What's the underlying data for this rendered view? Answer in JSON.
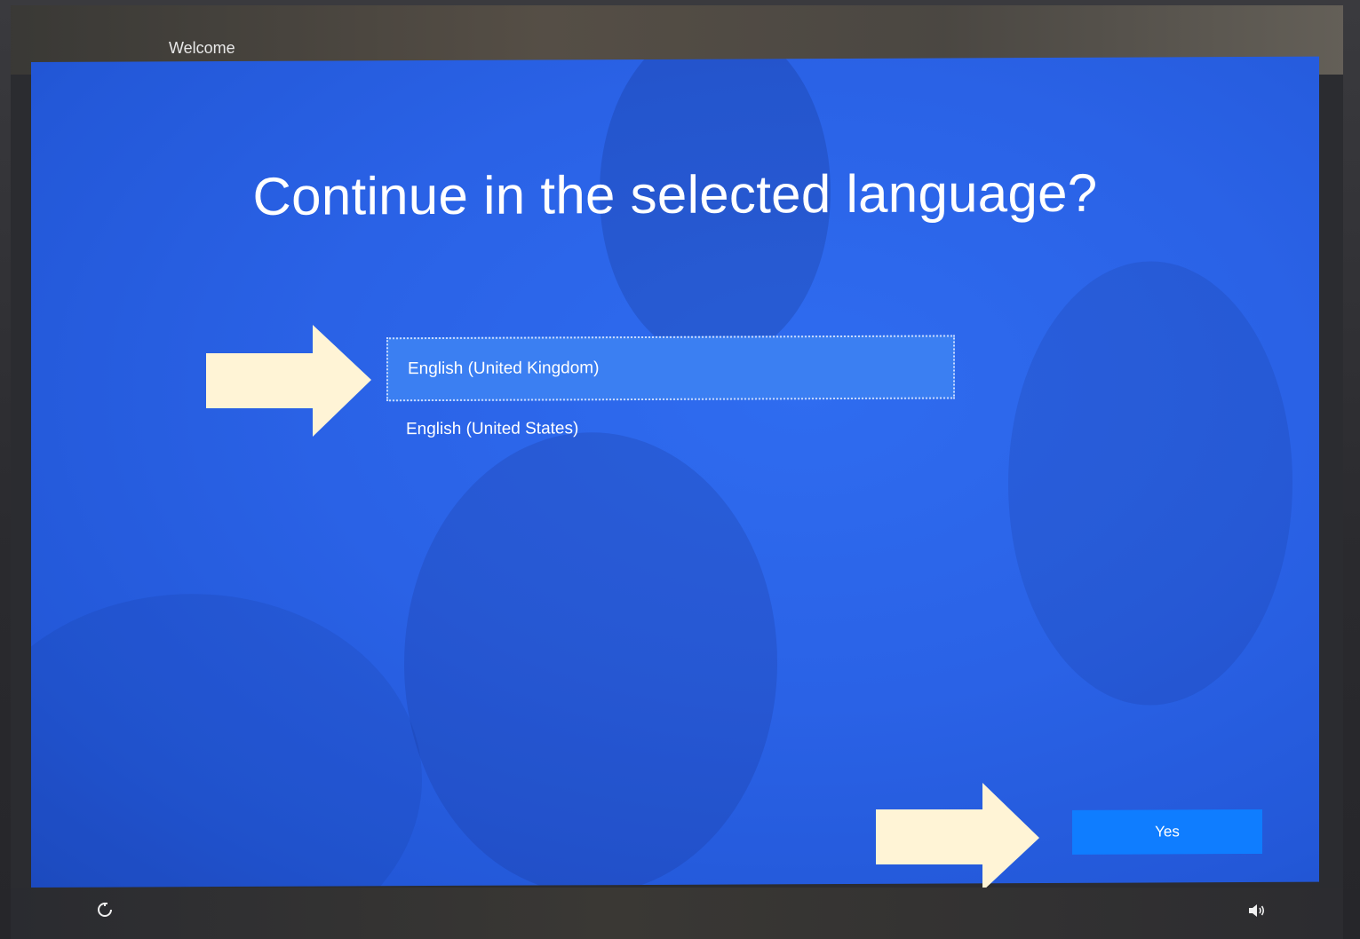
{
  "header": {
    "tab_label": "Welcome"
  },
  "main": {
    "title": "Continue in the selected language?",
    "languages": [
      {
        "label": "English (United Kingdom)",
        "selected": true
      },
      {
        "label": "English (United States)",
        "selected": false
      }
    ]
  },
  "actions": {
    "yes_label": "Yes"
  },
  "footer": {
    "left_icon": "ease-of-access-icon",
    "right_icon": "volume-icon"
  },
  "annotations": {
    "arrow_color": "#fff4d6",
    "arrows": [
      "arrow-to-english-uk",
      "arrow-to-yes-button"
    ]
  },
  "colors": {
    "oobe_blue": "#2a62e6",
    "selected_item": "#3b7ff2",
    "button_blue": "#0f7dff"
  }
}
